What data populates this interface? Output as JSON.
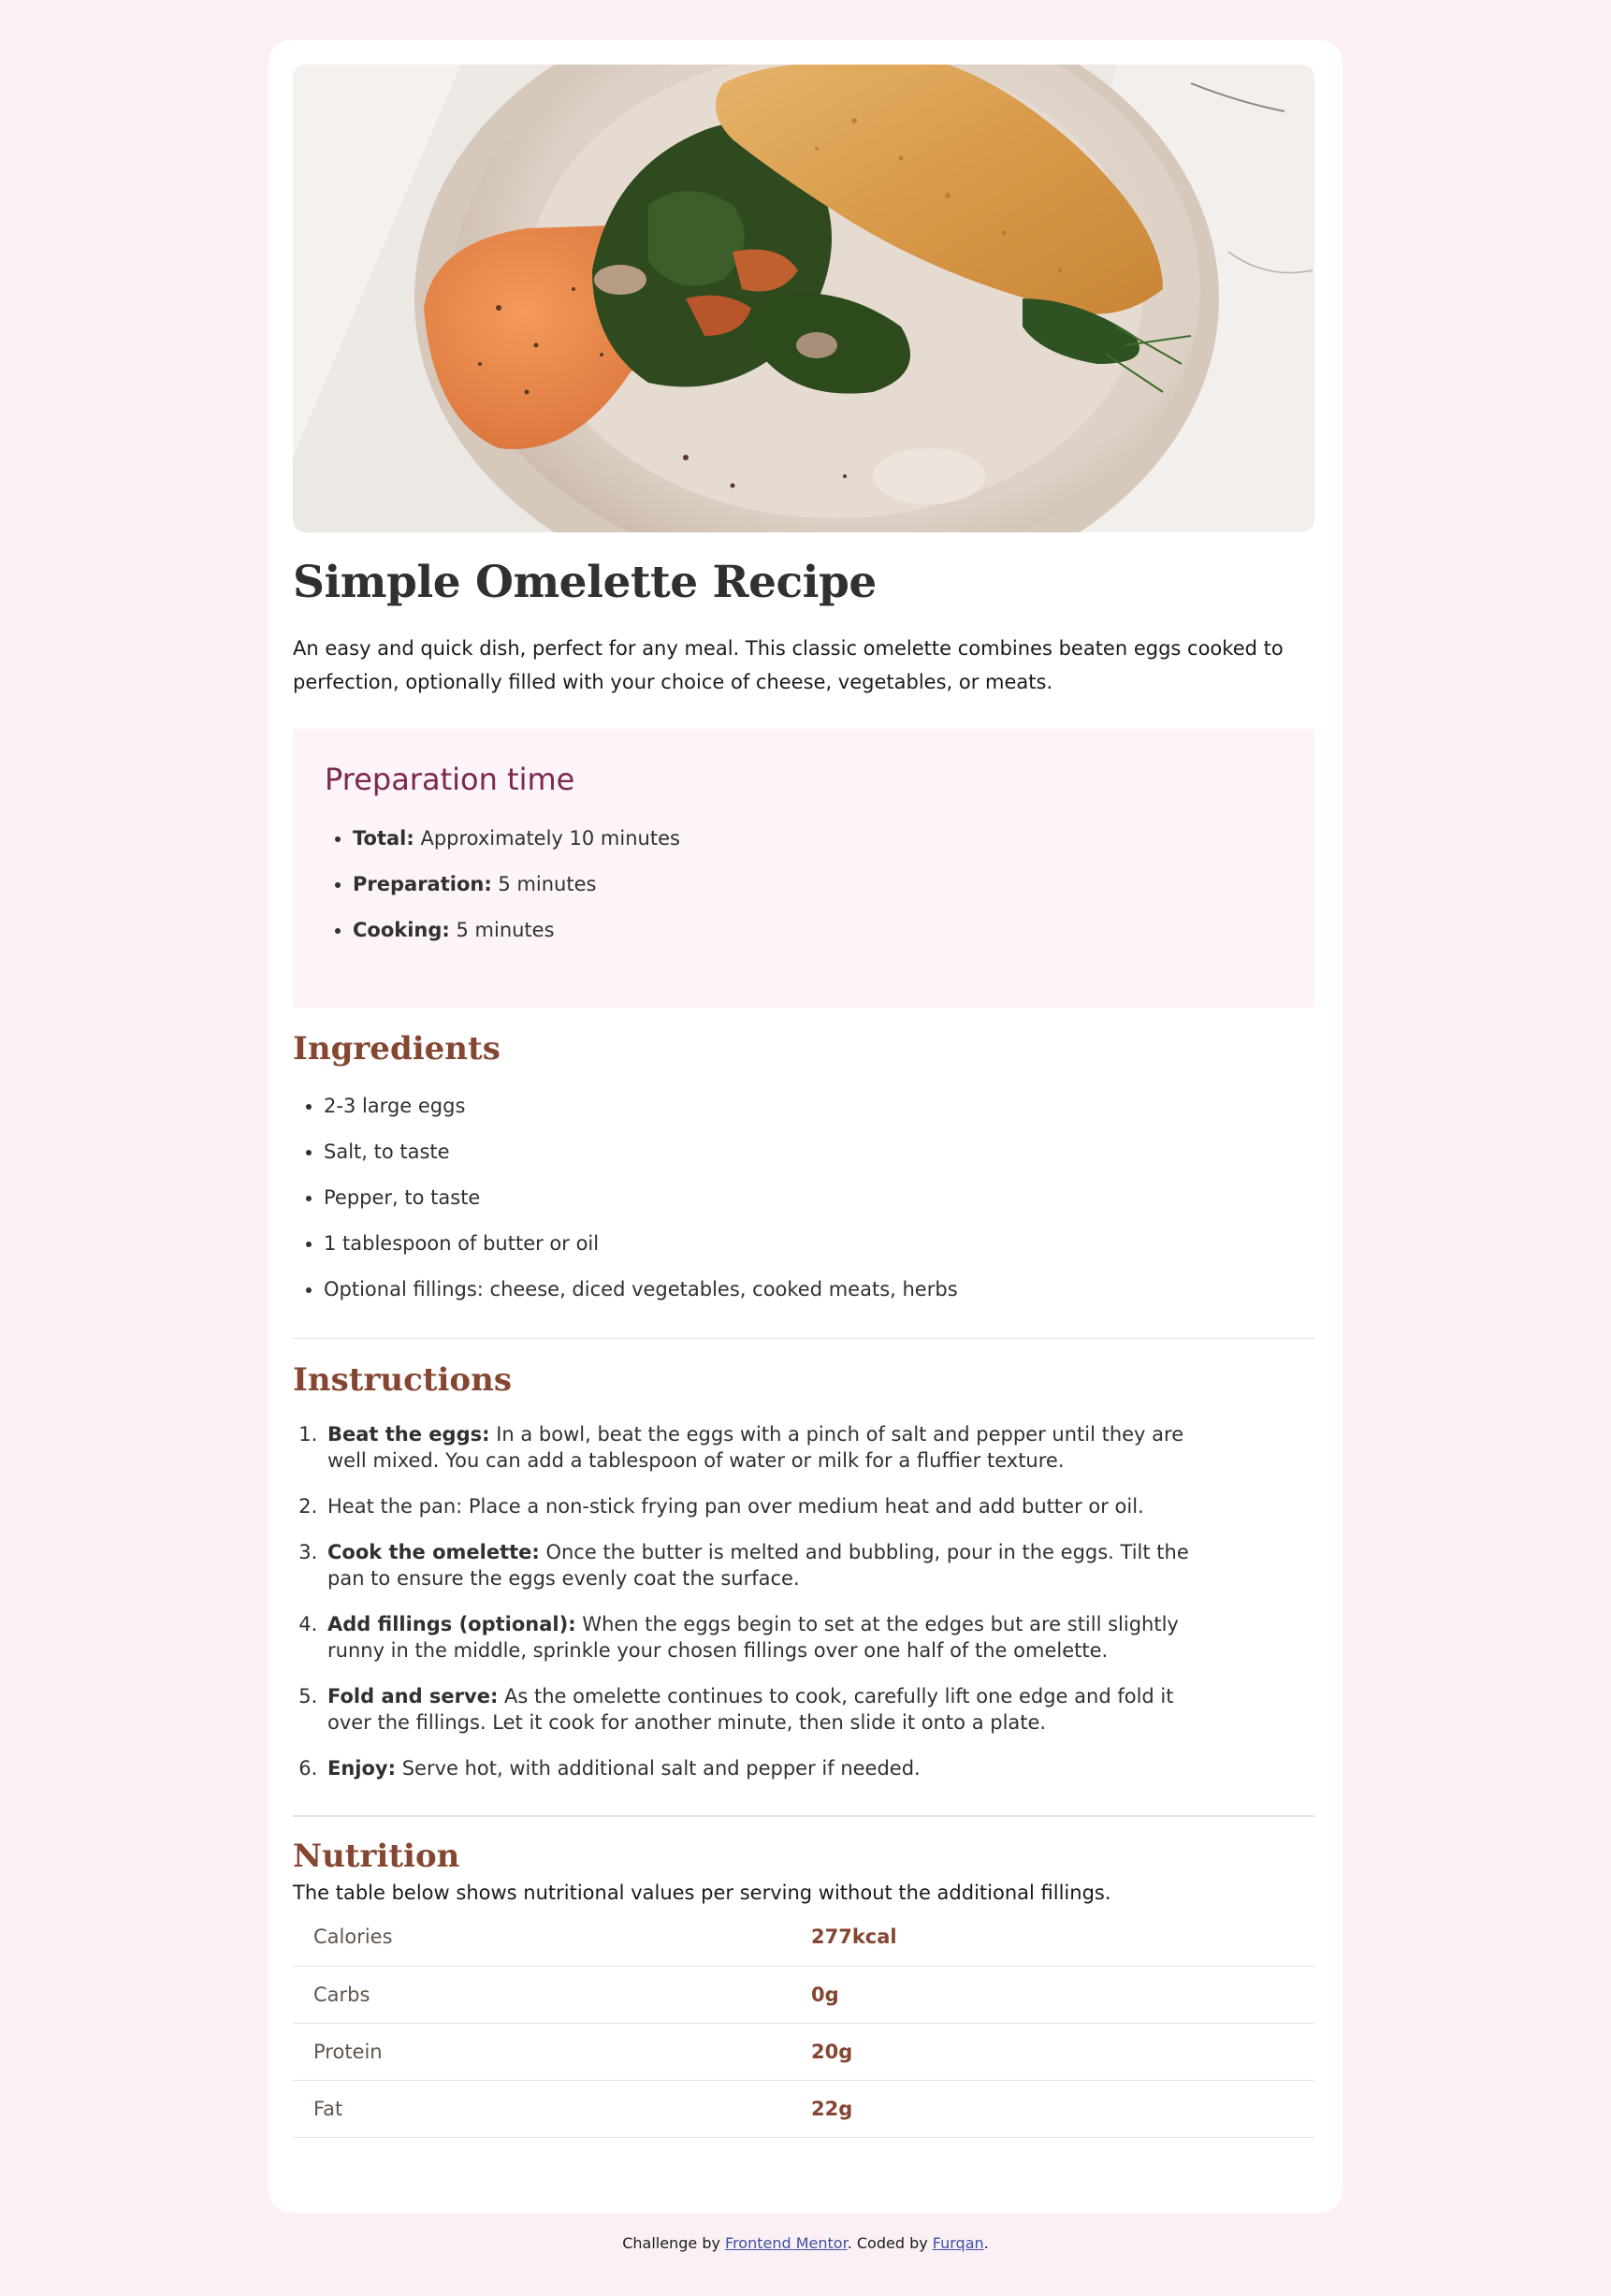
{
  "recipe": {
    "title": "Simple Omelette Recipe",
    "intro": "An easy and quick dish, perfect for any meal. This classic omelette combines beaten eggs cooked to perfection, optionally filled with your choice of cheese, vegetables, or meats."
  },
  "preparation": {
    "heading": "Preparation time",
    "items": [
      {
        "label": "Total:",
        "value": " Approximately 10 minutes"
      },
      {
        "label": "Preparation:",
        "value": " 5 minutes"
      },
      {
        "label": "Cooking:",
        "value": " 5 minutes"
      }
    ]
  },
  "ingredients": {
    "heading": "Ingredients",
    "items": [
      "2-3 large eggs",
      "Salt, to taste",
      "Pepper, to taste",
      "1 tablespoon of butter or oil",
      "Optional fillings: cheese, diced vegetables, cooked meats, herbs"
    ]
  },
  "instructions": {
    "heading": "Instructions",
    "steps": [
      {
        "label": "Beat the eggs:",
        "text": " In a bowl, beat the eggs with a pinch of salt and pepper until they are well mixed. You can add a tablespoon of water or milk for a fluffier texture."
      },
      {
        "label": "",
        "text": "Heat the pan: Place a non-stick frying pan over medium heat and add butter or oil."
      },
      {
        "label": "Cook the omelette:",
        "text": " Once the butter is melted and bubbling, pour in the eggs. Tilt the pan to ensure the eggs evenly coat the surface."
      },
      {
        "label": "Add fillings (optional):",
        "text": " When the eggs begin to set at the edges but are still slightly runny in the middle, sprinkle your chosen fillings over one half of the omelette."
      },
      {
        "label": "Fold and serve:",
        "text": " As the omelette continues to cook, carefully lift one edge and fold it over the fillings. Let it cook for another minute, then slide it onto a plate."
      },
      {
        "label": "Enjoy:",
        "text": " Serve hot, with additional salt and pepper if needed."
      }
    ]
  },
  "nutrition": {
    "heading": "Nutrition",
    "description": "The table below shows nutritional values per serving without the additional fillings.",
    "rows": [
      {
        "name": "Calories",
        "value": "277kcal"
      },
      {
        "name": "Carbs",
        "value": "0g"
      },
      {
        "name": "Protein",
        "value": "20g"
      },
      {
        "name": "Fat",
        "value": "22g"
      }
    ]
  },
  "footer": {
    "prefix": "Challenge by ",
    "link1": "Frontend Mentor",
    "middle": ". Coded by ",
    "link2": "Furqan",
    "suffix": "."
  },
  "colors": {
    "page_bg": "#fbf0f6",
    "card_bg": "#ffffff",
    "accent_brown": "#854632",
    "accent_plum": "#7a284e",
    "prep_bg": "#fdf4f9"
  }
}
